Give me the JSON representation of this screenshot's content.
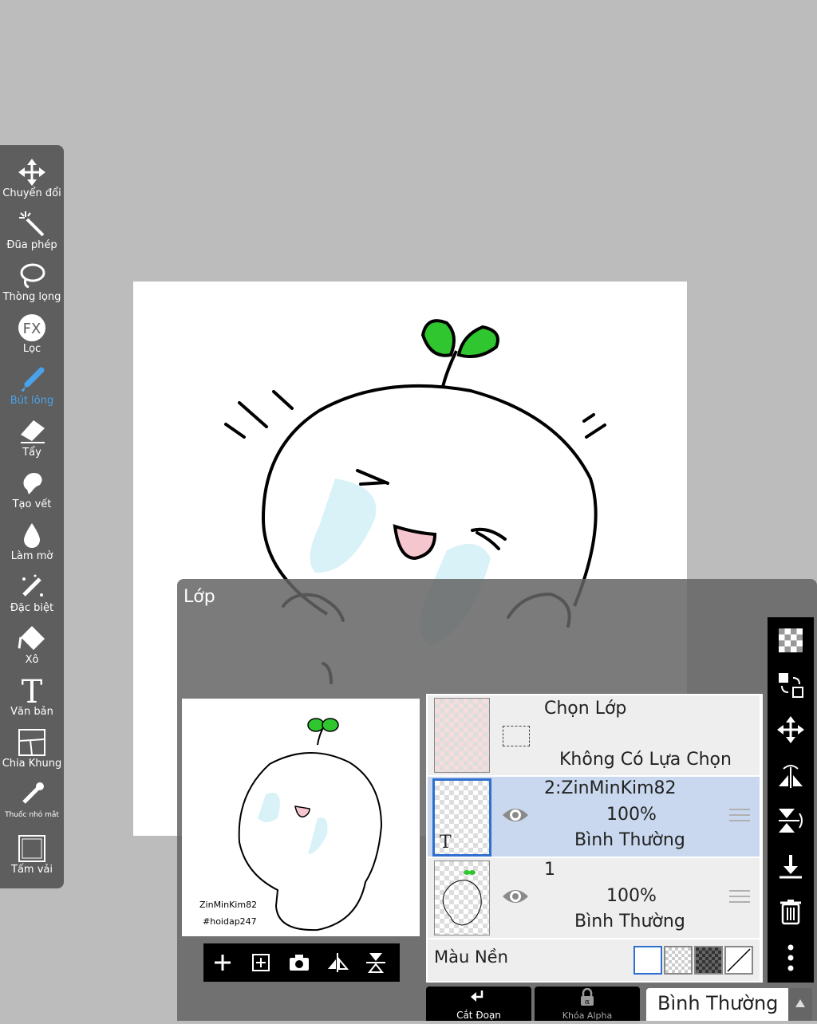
{
  "toolbar": {
    "tools": [
      {
        "label": "Chuyển đổi",
        "icon": "move-arrows-icon"
      },
      {
        "label": "Đũa phép",
        "icon": "magic-wand-icon"
      },
      {
        "label": "Thòng lọng",
        "icon": "lasso-icon"
      },
      {
        "label": "Lọc",
        "icon": "fx-filter-icon"
      },
      {
        "label": "Bút lông",
        "icon": "brush-icon",
        "active": true
      },
      {
        "label": "Tẩy",
        "icon": "eraser-icon"
      },
      {
        "label": "Tạo vết",
        "icon": "smudge-icon"
      },
      {
        "label": "Làm mờ",
        "icon": "blur-drop-icon"
      },
      {
        "label": "Đặc biệt",
        "icon": "special-pen-icon"
      },
      {
        "label": "Xô",
        "icon": "bucket-icon"
      },
      {
        "label": "Văn bản",
        "icon": "text-icon"
      },
      {
        "label": "Chia Khung",
        "icon": "frame-divider-icon"
      },
      {
        "label": "Thuốc nhỏ mắt",
        "icon": "eyedropper-icon"
      },
      {
        "label": "Tấm vải",
        "icon": "canvas-icon"
      }
    ],
    "active_color": "#4aa3ea"
  },
  "layer_panel": {
    "title": "Lớp",
    "preview": {
      "line1": "ZinMinKim82",
      "line2": "#hoidap247"
    },
    "selection_layer": {
      "title": "Chọn Lớp",
      "status": "Không Có Lựa Chọn"
    },
    "layers": [
      {
        "name": "2:ZinMinKim82",
        "opacity": "100%",
        "blend": "Bình Thường",
        "selected": true,
        "type_badge": "T"
      },
      {
        "name": "1",
        "opacity": "100%",
        "blend": "Bình Thường",
        "selected": false
      }
    ],
    "background": {
      "label": "Màu Nền"
    },
    "bottom": {
      "clip": "Cắt Đoạn",
      "alpha_lock": "Khóa Alpha",
      "blend_mode": "Bình Thường"
    }
  },
  "colors": {
    "toolbar_bg": "#5e5e5e",
    "selected_row": "#c9d8ee",
    "selected_border": "#2f6fd0"
  }
}
